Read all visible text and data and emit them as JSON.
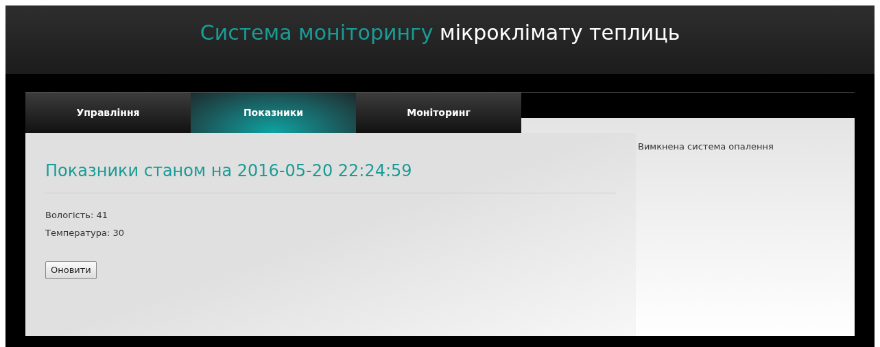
{
  "header": {
    "title_accent": "Система моніторингу",
    "title_rest": "мікроклімату теплиць"
  },
  "tabs": [
    {
      "label": "Управління",
      "selected": false
    },
    {
      "label": "Показники",
      "selected": true
    },
    {
      "label": "Моніторинг",
      "selected": false
    }
  ],
  "content": {
    "heading": "Показники станом на 2016-05-20 22:24:59",
    "readings": [
      "Вологість: 41",
      "Температура: 30"
    ],
    "button": "Оновити"
  },
  "sidebar": {
    "status": "Вимкнена система опалення"
  }
}
